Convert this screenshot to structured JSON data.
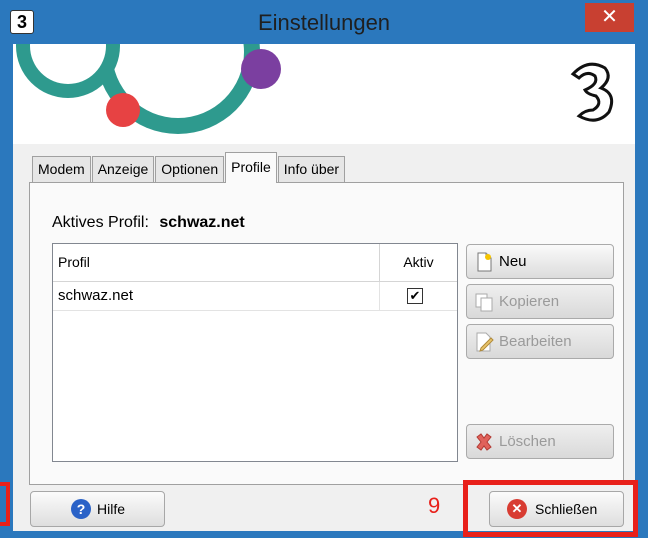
{
  "window": {
    "title": "Einstellungen",
    "app_icon_glyph": "3",
    "close_glyph": "✕"
  },
  "tabs": [
    {
      "label": "Modem",
      "active": false
    },
    {
      "label": "Anzeige",
      "active": false
    },
    {
      "label": "Optionen",
      "active": false
    },
    {
      "label": "Profile",
      "active": true
    },
    {
      "label": "Info über",
      "active": false
    }
  ],
  "profile": {
    "active_label": "Aktives Profil:",
    "active_value": "schwaz.net"
  },
  "table": {
    "columns": [
      "Profil",
      "Aktiv"
    ],
    "rows": [
      {
        "profil": "schwaz.net",
        "aktiv": true,
        "check_glyph": "✔"
      }
    ]
  },
  "buttons": {
    "neu": "Neu",
    "kopieren": "Kopieren",
    "bearbeiten": "Bearbeiten",
    "loeschen": "Löschen",
    "hilfe": "Hilfe",
    "schliessen": "Schließen"
  },
  "annotation": {
    "number": "9",
    "color": "#e8201a"
  },
  "colors": {
    "titlebar": "#2b78bd",
    "close_button": "#c84031",
    "brand_teal": "#2e9a8e",
    "brand_purple": "#7b3fa0",
    "brand_red": "#e74243"
  },
  "icons": [
    "app-icon",
    "close-icon",
    "three-logo",
    "new-file-icon",
    "copy-icon",
    "edit-icon",
    "delete-icon",
    "help-icon",
    "close-circle-icon"
  ]
}
